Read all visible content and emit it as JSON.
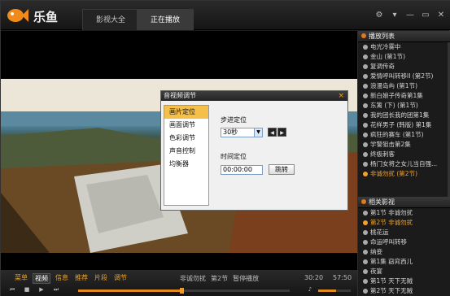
{
  "app": {
    "brand": "乐鱼"
  },
  "tabs": [
    {
      "label": "影视大全"
    },
    {
      "label": "正在播放"
    }
  ],
  "window_controls": {
    "settings": "⚙",
    "pin": "▾",
    "min": "—",
    "restore": "▭",
    "close": "✕"
  },
  "dialog": {
    "title": "音视频调节",
    "close": "×",
    "menu": [
      "画片定位",
      "画面调节",
      "色彩调节",
      "声音控制",
      "均衡器"
    ],
    "step_label": "步进定位",
    "step_value": "30秒",
    "time_label": "时间定位",
    "time_value": "00:00:00",
    "jump": "跳转"
  },
  "sidebar": {
    "playlist_header": "播放列表",
    "playlist": [
      "电光冷雾中",
      "金山 (第1节)",
      "复调传奇",
      "爱情呼叫转移II (第2节)",
      "浪漫岛屿 (第1节)",
      "新白娘子传奇第1集",
      "东篱 (下) (第1节)",
      "我的团长我的团第1集",
      "花样男子 (韩版) 第1集",
      "疯狂的赛车 (第1节)",
      "学警狙击第2集",
      "终极刺客",
      "杨门女将之女儿当自强...",
      "非诚勿扰 (第2节)"
    ],
    "playlist_highlight_index": 13,
    "related_header": "相关影视",
    "related": [
      "第1节 非诚勿扰",
      "第2节 非诚勿扰",
      "桃花运",
      "命运呼叫转移",
      "纳妾",
      "第1集 窈窕西儿",
      "夜宴",
      "第1节 天下无贼",
      "第2节 天下无贼"
    ],
    "related_highlight_index": 1
  },
  "bottom": {
    "tabs": [
      "菜单",
      "视频",
      "信息",
      "推荐",
      "片段",
      "调节"
    ],
    "active_tab_index": 1,
    "title_parts": [
      "非诚勿扰",
      "第2节",
      "暂停播放"
    ],
    "time_pos": "30:20",
    "time_len": "57:50",
    "progress_fraction": 0.49,
    "volume_fraction": 0.55
  },
  "colors": {
    "accent": "#f0a020",
    "dialog_menu_selected": "#f5c04a"
  }
}
